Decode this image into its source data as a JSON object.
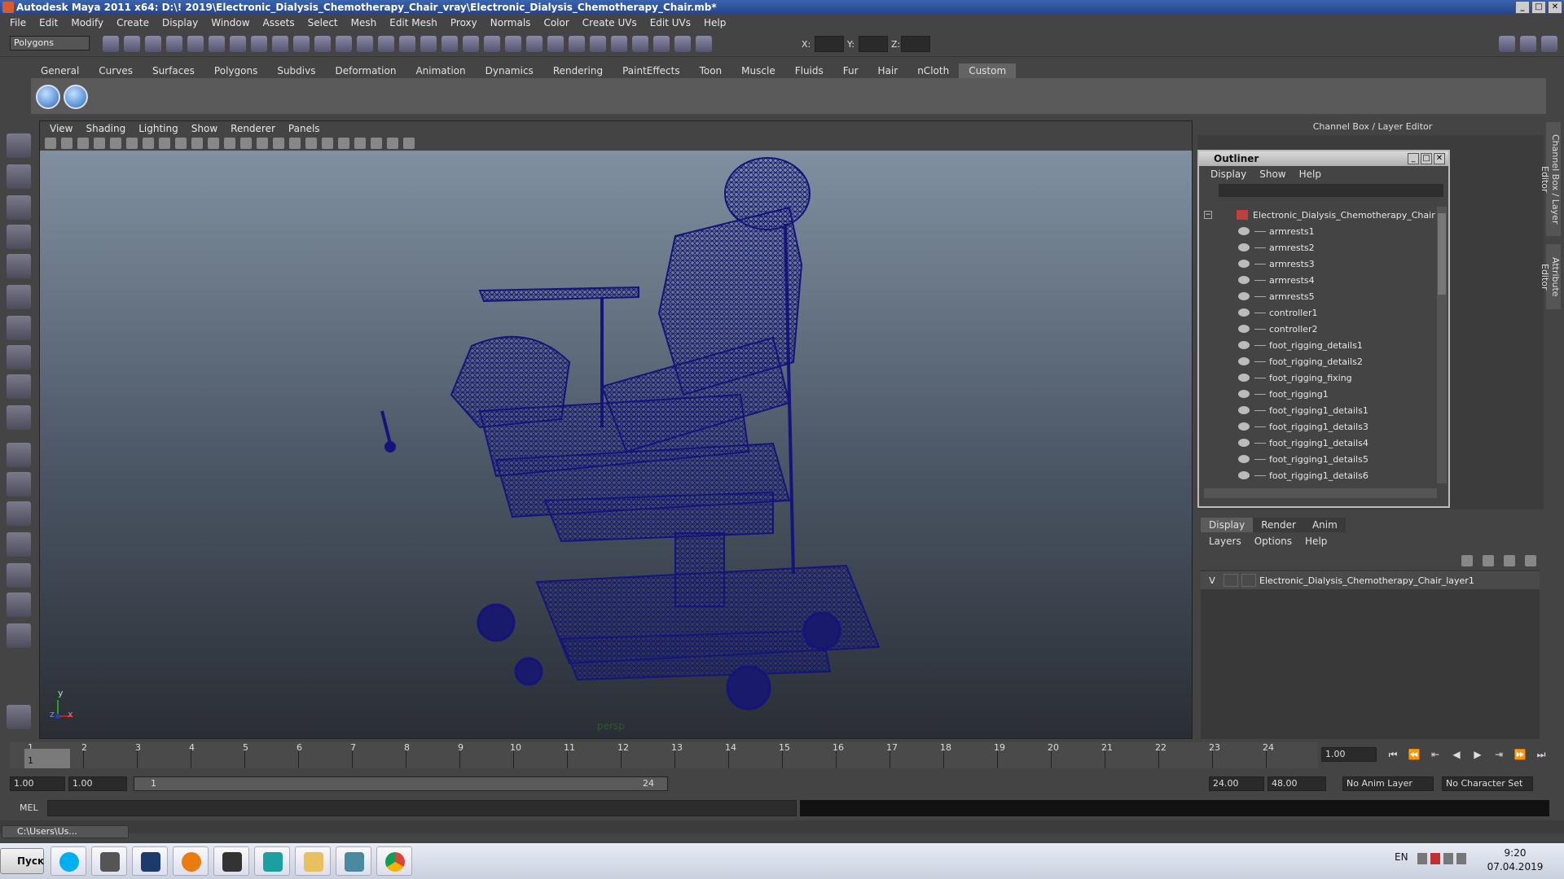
{
  "window": {
    "title": "Autodesk Maya 2011 x64: D:\\! 2019\\Electronic_Dialysis_Chemotherapy_Chair_vray\\Electronic_Dialysis_Chemotherapy_Chair.mb*",
    "min": "_",
    "max": "□",
    "close": "✕"
  },
  "menubar": [
    "File",
    "Edit",
    "Modify",
    "Create",
    "Display",
    "Window",
    "Assets",
    "Select",
    "Mesh",
    "Edit Mesh",
    "Proxy",
    "Normals",
    "Color",
    "Create UVs",
    "Edit UVs",
    "Help"
  ],
  "statusline": {
    "mode": "Polygons",
    "x_label": "X:",
    "y_label": "Y:",
    "z_label": "Z:"
  },
  "shelf": {
    "tabs": [
      "General",
      "Curves",
      "Surfaces",
      "Polygons",
      "Subdivs",
      "Deformation",
      "Animation",
      "Dynamics",
      "Rendering",
      "PaintEffects",
      "Toon",
      "Muscle",
      "Fluids",
      "Fur",
      "Hair",
      "nCloth",
      "Custom"
    ],
    "active": "Custom"
  },
  "viewport": {
    "menu": [
      "View",
      "Shading",
      "Lighting",
      "Show",
      "Renderer",
      "Panels"
    ],
    "camera": "persp",
    "axis_y": "y",
    "axis_x": "x",
    "axis_z": "z"
  },
  "channel_box": {
    "title": "Channel Box / Layer Editor"
  },
  "outliner": {
    "title": "Outliner",
    "menu": [
      "Display",
      "Show",
      "Help"
    ],
    "root": "Electronic_Dialysis_Chemotherapy_Chair",
    "items": [
      "armrests1",
      "armrests2",
      "armrests3",
      "armrests4",
      "armrests5",
      "controller1",
      "controller2",
      "foot_rigging_details1",
      "foot_rigging_details2",
      "foot_rigging_fixing",
      "foot_rigging1",
      "foot_rigging1_details1",
      "foot_rigging1_details3",
      "foot_rigging1_details4",
      "foot_rigging1_details5",
      "foot_rigging1_details6"
    ]
  },
  "layers": {
    "tabs": [
      "Display",
      "Render",
      "Anim"
    ],
    "active": "Display",
    "menu": [
      "Layers",
      "Options",
      "Help"
    ],
    "rows": [
      {
        "v": "V",
        "name": "Electronic_Dialysis_Chemotherapy_Chair_layer1"
      }
    ]
  },
  "side_tabs": [
    "Channel Box / Layer Editor",
    "Attribute Editor"
  ],
  "timeline": {
    "ticks": [
      "1",
      "2",
      "3",
      "4",
      "5",
      "6",
      "7",
      "8",
      "9",
      "10",
      "11",
      "12",
      "13",
      "14",
      "15",
      "16",
      "17",
      "18",
      "19",
      "20",
      "21",
      "22",
      "23",
      "24"
    ],
    "current_frame": "1.00",
    "current_marker": "1"
  },
  "range": {
    "start": "1.00",
    "playback_start": "1.00",
    "slider_start": "1",
    "slider_end": "24",
    "playback_end": "24.00",
    "end": "48.00",
    "anim_layer": "No Anim Layer",
    "char_set": "No Character Set"
  },
  "command": {
    "label": "MEL"
  },
  "minimized_window": "C:\\Users\\Us...",
  "taskbar": {
    "start": "Пуск",
    "lang": "EN",
    "time": "9:20",
    "date": "07.04.2019"
  },
  "colors": {
    "wireframe": "#14147a",
    "title_blue": "#2a4e9c"
  }
}
